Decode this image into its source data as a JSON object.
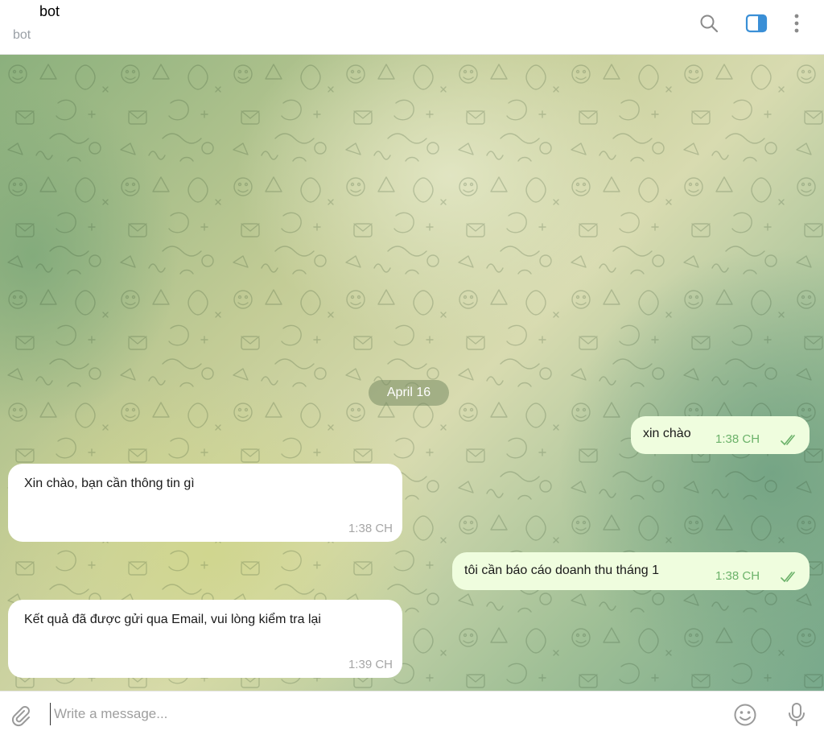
{
  "header": {
    "title": "bot",
    "subtitle": "bot",
    "icons": [
      "search-icon",
      "sidebar-toggle-icon",
      "more-vertical-icon"
    ]
  },
  "chat": {
    "date_label": "April 16",
    "messages": [
      {
        "direction": "out",
        "text": "xin chào",
        "time": "1:38 CH",
        "status": "read"
      },
      {
        "direction": "in",
        "text": "Xin chào, bạn cần thông tin gì",
        "time": "1:38 CH"
      },
      {
        "direction": "out",
        "text": "tôi cần báo cáo doanh thu tháng 1",
        "time": "1:38 CH",
        "status": "read"
      },
      {
        "direction": "in",
        "text": "Kết quả đã được gửi qua Email, vui lòng kiểm tra lại",
        "time": "1:39 CH"
      }
    ]
  },
  "composer": {
    "placeholder": "Write a message...",
    "value": "",
    "icons": [
      "paperclip-icon",
      "emoji-icon",
      "microphone-icon"
    ]
  },
  "colors": {
    "accent": "#3a8fd6",
    "outgoing_bubble": "#effdde",
    "incoming_bubble": "#ffffff",
    "outgoing_time": "#6cb26a"
  }
}
